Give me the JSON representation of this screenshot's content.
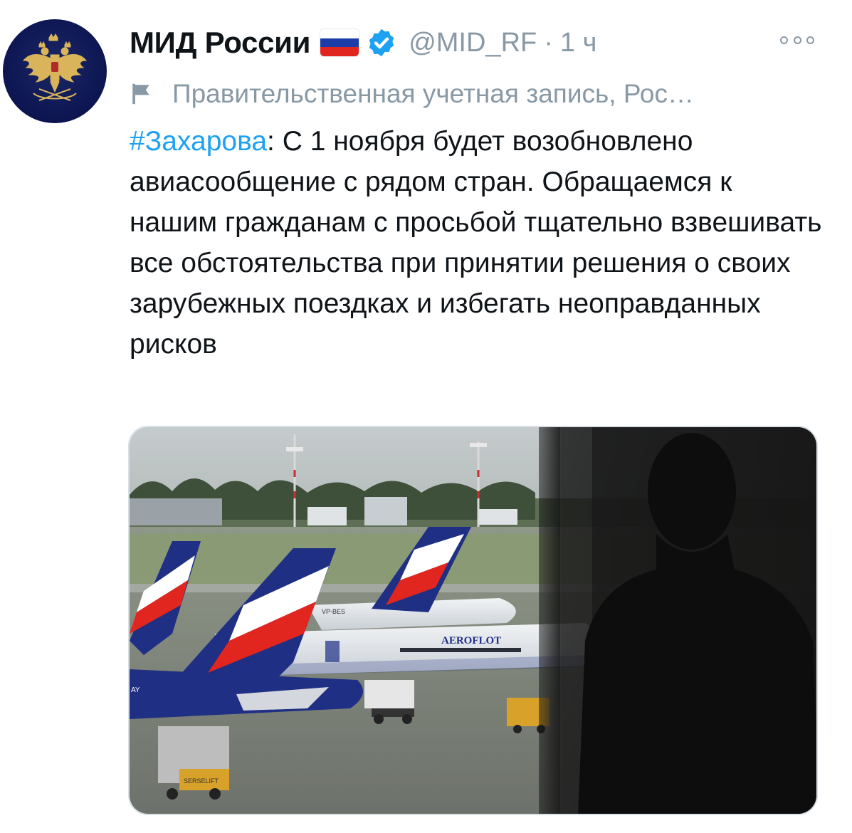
{
  "tweet": {
    "display_name": "МИД России",
    "handle": "@MID_RF",
    "separator": "·",
    "time": "1 ч",
    "label": "Правительственная учетная запись, Рос…",
    "hashtag": "#Захарова",
    "text_after_hashtag": ":  С 1 ноября будет возобновлено авиасообщение с рядом стран. Обращаемся к нашим гражданам с просьбой тщательно взвешивать все обстоятельства при принятии решения о своих зарубежных поездках и избегать неоправданных рисков",
    "icons": {
      "flag": "russia-flag-icon",
      "verified": "verified-badge-icon",
      "more": "more-options-icon",
      "government_label": "government-flag-icon"
    }
  },
  "media": {
    "airline_text": "AEROFLOT",
    "registration": "VP-BES",
    "tail_text": "AY",
    "truck_text": "SERSELIFT"
  },
  "colors": {
    "verified": "#1da1f2",
    "hashtag": "#1da1f2",
    "secondary_text": "#8899a6",
    "avatar_bg": "#0c1550",
    "aeroflot_blue": "#1e2f84",
    "flag_white": "#ffffff",
    "flag_blue": "#1c3ca8",
    "flag_red": "#e0261f"
  }
}
